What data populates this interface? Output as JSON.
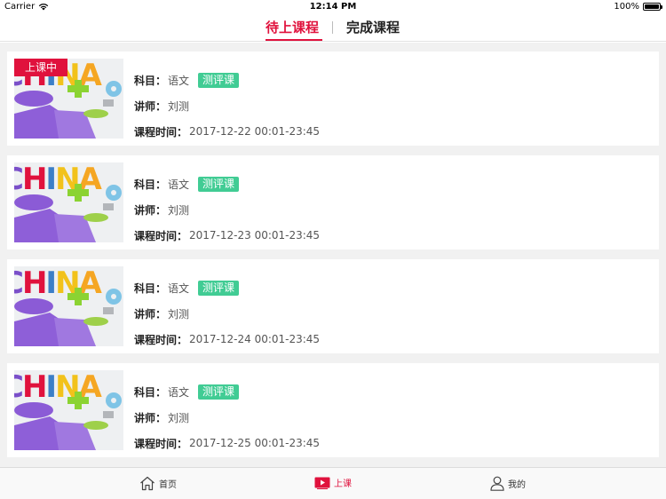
{
  "status_bar": {
    "carrier": "Carrier",
    "time": "12:14 PM",
    "battery": "100%"
  },
  "tabs": [
    {
      "label": "待上课程",
      "active": true
    },
    {
      "label": "完成课程",
      "active": false
    }
  ],
  "labels": {
    "subject": "科目：",
    "teacher": "讲师：",
    "time": "课程时间："
  },
  "live_badge": "上课中",
  "courses": [
    {
      "subject": "语文",
      "tag": "测评课",
      "teacher": "刘测",
      "time": "2017-12-22 00:01-23:45",
      "live": true
    },
    {
      "subject": "语文",
      "tag": "测评课",
      "teacher": "刘测",
      "time": "2017-12-23 00:01-23:45",
      "live": false
    },
    {
      "subject": "语文",
      "tag": "测评课",
      "teacher": "刘测",
      "time": "2017-12-24 00:01-23:45",
      "live": false
    },
    {
      "subject": "语文",
      "tag": "测评课",
      "teacher": "刘测",
      "time": "2017-12-25 00:01-23:45",
      "live": false
    }
  ],
  "thumbnail_text": "CHINA",
  "bottom_nav": [
    {
      "label": "首页",
      "icon": "home-icon"
    },
    {
      "label": "上课",
      "icon": "play-icon",
      "active": true
    },
    {
      "label": "我的",
      "icon": "user-icon"
    }
  ],
  "colors": {
    "accent": "#e0123d",
    "tag": "#41cc94",
    "background": "#f1f1f1"
  }
}
